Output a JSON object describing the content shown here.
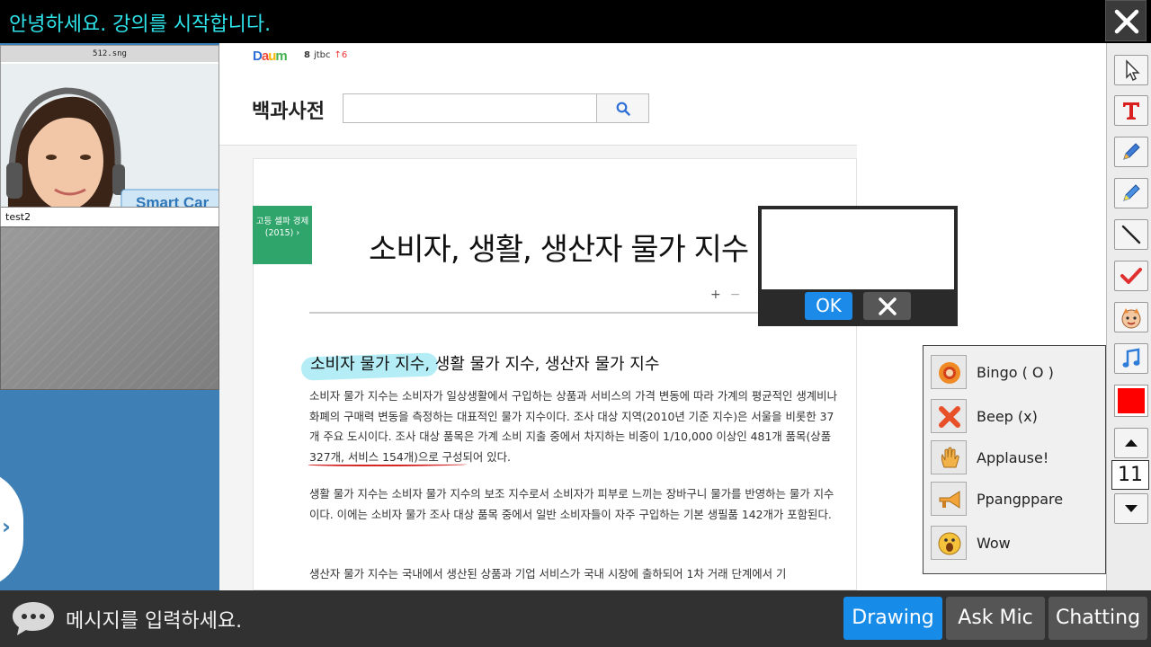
{
  "header": {
    "title": "안녕하세요. 강의를 시작합니다."
  },
  "left_panel": {
    "video1_filename": "512.sng",
    "video1_username": "test2"
  },
  "document": {
    "logo": "Daum",
    "trend_rank": "8",
    "trend_word": "jtbc",
    "trend_change": "6",
    "dict_title": "백과사전",
    "search_value": "",
    "category": "고등 셀파 경제(2015)",
    "article_title": "소비자, 생활, 생산자 물가 지수",
    "zoom_plus": "+",
    "zoom_minus": "−",
    "subheading": "소비자 물가 지수, 생활 물가 지수, 생산자 물가 지수",
    "paragraph1": "소비자 물가 지수는 소비자가 일상생활에서 구입하는 상품과 서비스의 가격 변동에 따라 가계의 평균적인 생계비나 화폐의 구매력 변동을 측정하는 대표적인 물가 지수이다. 조사 대상 지역(2010년 기준 지수)은 서울을 비롯한 37개 주요 도시이다. 조사 대상 품목은 가계 소비 지출 중에서 차지하는 비중이 1/10,000 이상인 481개 품목(상품 327개, 서비스 154개)으로 구성되어 있다.",
    "paragraph2": "생활 물가 지수는 소비자 물가 지수의 보조 지수로서 소비자가 피부로 느끼는 장바구니 물가를 반영하는 물가 지수이다. 이에는 소비자 물가 조사 대상 품목 중에서 일반 소비자들이 자주 구입하는 기본 생필품 142개가 포함된다.",
    "paragraph3": "생산자 물가 지수는 국내에서 생산된 상품과 기업 서비스가 국내 시장에 출하되어 1차 거래 단계에서 기"
  },
  "popup": {
    "text_value": "",
    "ok_label": "OK"
  },
  "reactions": [
    {
      "label": "Bingo ( O )",
      "icon": "bingo-icon"
    },
    {
      "label": "Beep (x)",
      "icon": "beep-icon"
    },
    {
      "label": "Applause!",
      "icon": "applause-icon"
    },
    {
      "label": "Ppangppare",
      "icon": "horn-icon"
    },
    {
      "label": "Wow",
      "icon": "wow-icon"
    }
  ],
  "toolbar": {
    "tools": [
      "pointer-icon",
      "text-icon",
      "pen-icon",
      "highlighter-icon",
      "line-icon",
      "check-icon",
      "sticker-icon",
      "music-icon"
    ],
    "color": "#ff0000",
    "size_value": "11"
  },
  "bottom": {
    "message_placeholder": "메시지를 입력하세요.",
    "drawing_label": "Drawing",
    "mic_label": "Ask Mic",
    "chat_label": "Chatting",
    "active_color": "#178be8"
  }
}
